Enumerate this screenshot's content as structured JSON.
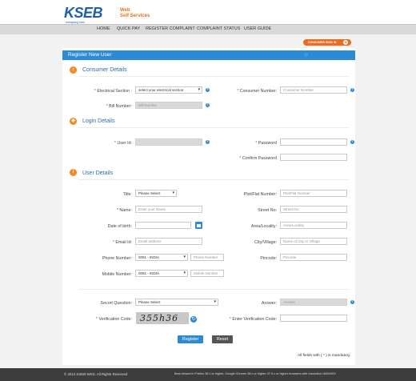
{
  "brand": {
    "logo_text": "KSEB",
    "tagline": "energising lives",
    "service_line1": "Web",
    "service_line2": "Self Services",
    "brand_color": "#1d5fa8",
    "accent_color": "#f08a24"
  },
  "nav": {
    "items": [
      "HOME",
      "QUICK PAY",
      "REGISTER COMPLAINT",
      "COMPLAINT STATUS",
      "USER GUIDE"
    ]
  },
  "signin": {
    "label": "CONSUMER SIGN IN",
    "icon": "sign-in-icon"
  },
  "page": {
    "title": "Register New User"
  },
  "consumer": {
    "title": "Consumer Details",
    "icon": "house-icon",
    "section_label": "Electrical Section :",
    "section_value": "select your electrical section",
    "consumer_number_label": "Consumer Number:",
    "consumer_number_ph": "Consumer Number",
    "bill_number_label": "Bill Number:",
    "bill_number_ph": "Bill Number"
  },
  "login": {
    "title": "Login Details",
    "icon": "lock-icon",
    "user_id_label": "User Id:",
    "password_label": "Password",
    "confirm_label": "Confirm Password"
  },
  "user": {
    "title": "User Details",
    "icon": "info-icon",
    "title_label": "Title:",
    "title_value": "Please Select",
    "name_label": "Name:",
    "name_ph": "Enter your Name",
    "dob_label": "Date of birth:",
    "email_label": "Email Id:",
    "email_ph": "Email address",
    "phone_label": "Phone Number:",
    "phone_code": "0091 - INDIA",
    "phone_ph": "Phone Number",
    "mobile_label": "Mobile Number:",
    "mobile_code": "0091 - INDIA",
    "mobile_ph": "Mobile Number",
    "plot_label": "Plot/Flat Number:",
    "plot_ph": "Plot/Flat Number",
    "street_label": "Street No:",
    "street_ph": "Street No",
    "area_label": "Area/Locality:",
    "area_ph": "Area/Locality",
    "city_label": "City/Village:",
    "city_ph": "Name of City or Village",
    "pincode_label": "Pincode:",
    "pincode_ph": "Pincode"
  },
  "security": {
    "question_label": "Secret Question:",
    "question_value": "Please Select",
    "answer_label": "Answer:",
    "answer_ph": "Answer",
    "verify_label": "Verification Code:",
    "captcha_text": "355h36",
    "enter_verify_label": "Enter Verification Code:"
  },
  "buttons": {
    "register": "Register",
    "reset": "Reset"
  },
  "notes": {
    "mandatory": "All fields with ( * ) is mandatory"
  },
  "footer": {
    "copyright": "© 2013 KSEB-WSS. All Rights Reserved",
    "browser_note": "Best viewed in Firefox 36.x or higher, Google Chrome 38.x or higher, IE 9.x or higher browsers with resolution 1600x900"
  }
}
